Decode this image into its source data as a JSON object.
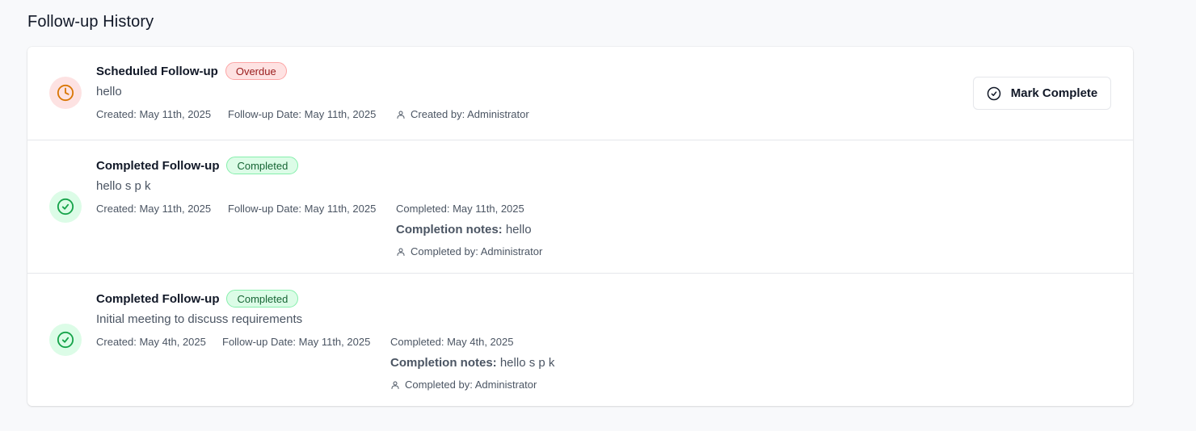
{
  "section": {
    "title": "Follow-up History"
  },
  "followups": [
    {
      "title": "Scheduled Follow-up",
      "status": "Overdue",
      "status_icon": "clock-icon",
      "description": "hello",
      "created": "Created: May 11th, 2025",
      "followup_date": "Follow-up Date: May 11th, 2025",
      "created_by": "Created by: Administrator",
      "action_label": "Mark Complete"
    },
    {
      "title": "Completed Follow-up",
      "status": "Completed",
      "status_icon": "check-circle-icon",
      "description": "hello s p k",
      "created": "Created: May 11th, 2025",
      "followup_date": "Follow-up Date: May 11th, 2025",
      "completed": "Completed: May 11th, 2025",
      "notes_label": "Completion notes:",
      "notes_value": "hello",
      "completed_by": "Completed by: Administrator"
    },
    {
      "title": "Completed Follow-up",
      "status": "Completed",
      "status_icon": "check-circle-icon",
      "description": "Initial meeting to discuss requirements",
      "created": "Created: May 4th, 2025",
      "followup_date": "Follow-up Date: May 11th, 2025",
      "completed": "Completed: May 4th, 2025",
      "notes_label": "Completion notes:",
      "notes_value": "hello s p k",
      "completed_by": "Completed by: Administrator"
    }
  ],
  "colors": {
    "overdue": "#d97706",
    "overdue_bg": "#fde2e2",
    "completed": "#16a34a",
    "completed_bg": "#dcfce7"
  }
}
